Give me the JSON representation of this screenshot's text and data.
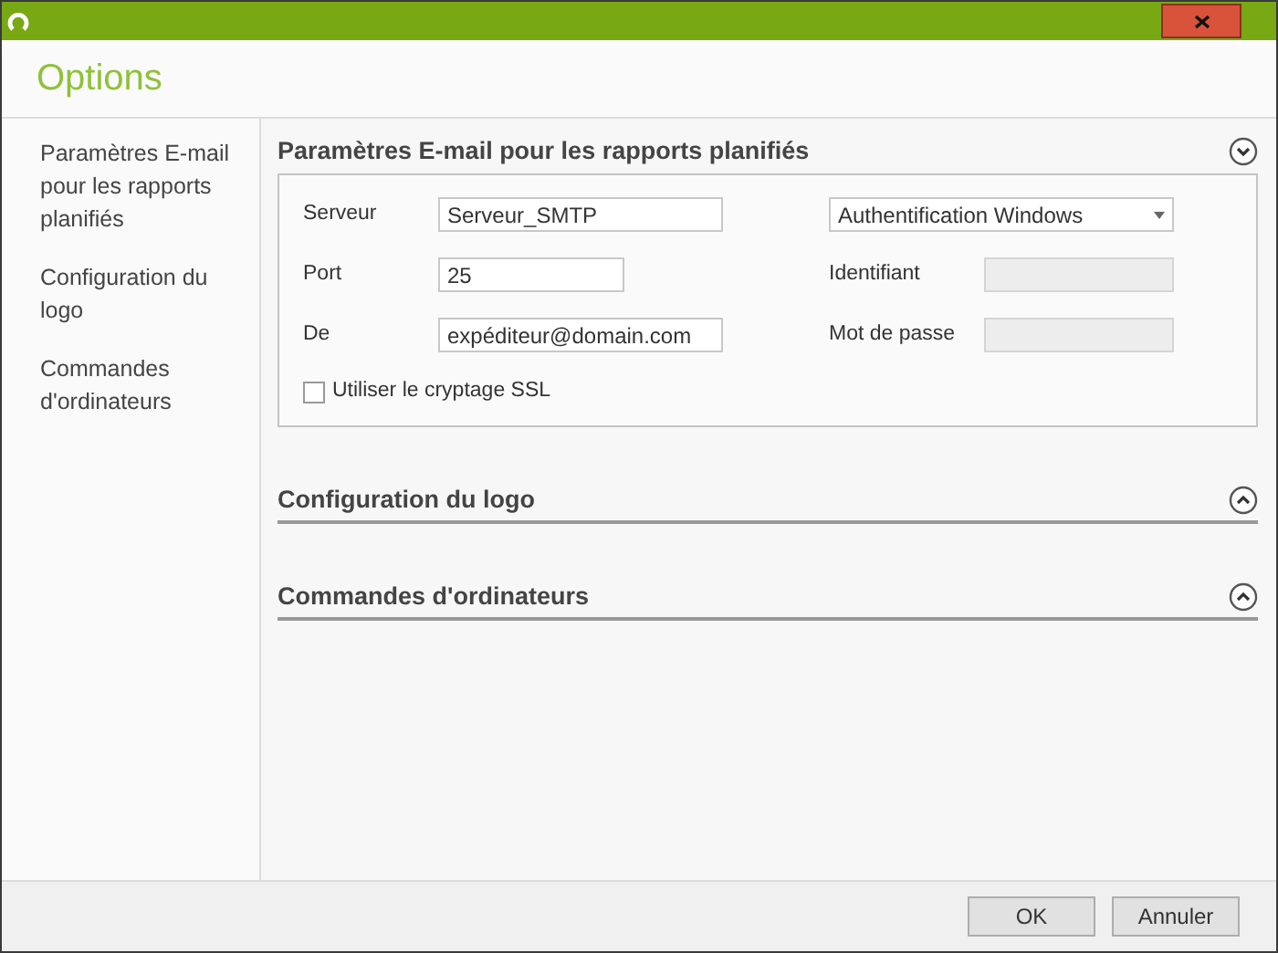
{
  "window": {
    "title": "Options"
  },
  "sidebar": {
    "items": [
      {
        "label": "Paramètres E-mail pour les rapports planifiés"
      },
      {
        "label": "Configuration du logo"
      },
      {
        "label": "Commandes d'ordinateurs"
      }
    ]
  },
  "sections": [
    {
      "title": "Paramètres E-mail pour les rapports planifiés",
      "expanded": true,
      "fields": [
        {
          "label": "Serveur",
          "value": "Serveur_SMTP",
          "kind": "text",
          "disabled": false
        },
        {
          "value": "Authentification Windows",
          "kind": "select"
        },
        {
          "label": "Port",
          "value": "25",
          "kind": "short",
          "disabled": false
        },
        {
          "label": "Identifiant",
          "kind": "text",
          "disabled": true
        },
        {
          "label": "De",
          "value": "expéditeur@domain.com",
          "kind": "text",
          "disabled": false
        },
        {
          "label": "Mot de passe",
          "kind": "text",
          "disabled": true
        }
      ],
      "checkbox": {
        "label": "Utiliser le cryptage SSL",
        "checked": false
      }
    },
    {
      "title": "Configuration du logo",
      "expanded": false
    },
    {
      "title": "Commandes d'ordinateurs",
      "expanded": false
    }
  ],
  "buttons": [
    "OK",
    "Annuler"
  ]
}
